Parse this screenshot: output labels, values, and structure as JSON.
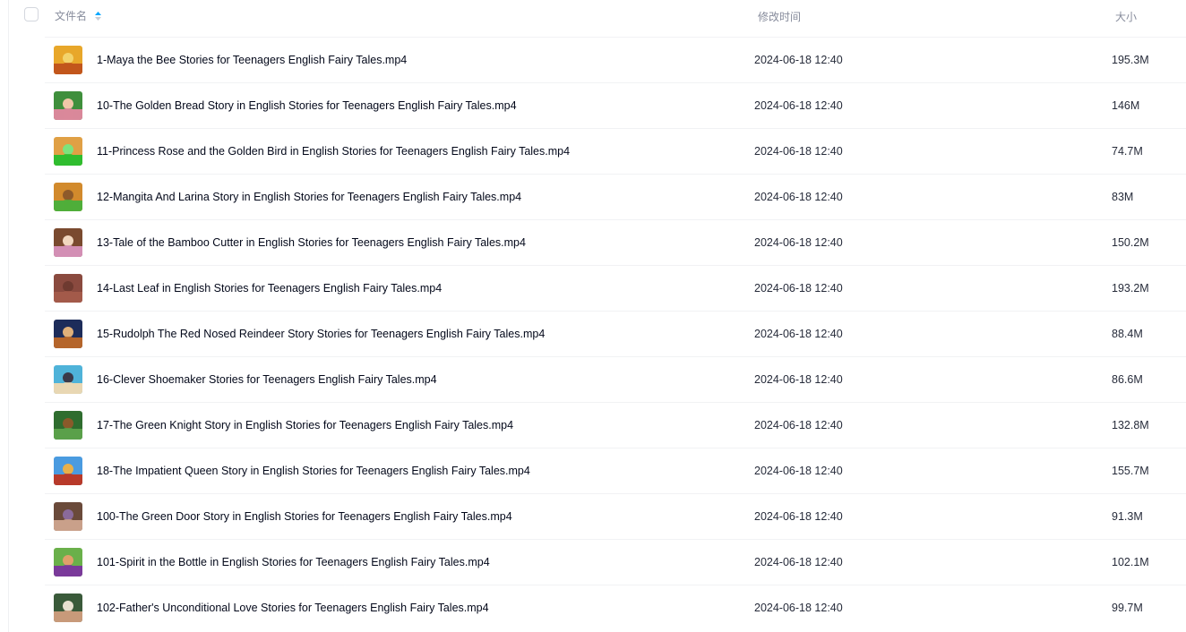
{
  "header": {
    "name_label": "文件名",
    "time_label": "修改时间",
    "size_label": "大小",
    "sort_icon": "sort-ascending-icon",
    "accent": "#06a7ff"
  },
  "files": [
    {
      "name": "1-Maya the Bee Stories for Teenagers English Fairy Tales.mp4",
      "time": "2024-06-18 12:40",
      "size": "195.3M"
    },
    {
      "name": "10-The Golden Bread Story in English Stories for Teenagers English Fairy Tales.mp4",
      "time": "2024-06-18 12:40",
      "size": "146M"
    },
    {
      "name": "11-Princess Rose and the Golden Bird in English Stories for Teenagers English Fairy Tales.mp4",
      "time": "2024-06-18 12:40",
      "size": "74.7M"
    },
    {
      "name": "12-Mangita And Larina Story in English Stories for Teenagers English Fairy Tales.mp4",
      "time": "2024-06-18 12:40",
      "size": "83M"
    },
    {
      "name": "13-Tale of the Bamboo Cutter in English Stories for Teenagers English Fairy Tales.mp4",
      "time": "2024-06-18 12:40",
      "size": "150.2M"
    },
    {
      "name": "14-Last Leaf in English Stories for Teenagers English Fairy Tales.mp4",
      "time": "2024-06-18 12:40",
      "size": "193.2M"
    },
    {
      "name": "15-Rudolph The Red Nosed Reindeer Story Stories for Teenagers English Fairy Tales.mp4",
      "time": "2024-06-18 12:40",
      "size": "88.4M"
    },
    {
      "name": "16-Clever Shoemaker Stories for Teenagers English Fairy Tales.mp4",
      "time": "2024-06-18 12:40",
      "size": "86.6M"
    },
    {
      "name": "17-The Green Knight Story in English Stories for Teenagers English Fairy Tales.mp4",
      "time": "2024-06-18 12:40",
      "size": "132.8M"
    },
    {
      "name": "18-The Impatient Queen Story in English Stories for Teenagers English Fairy Tales.mp4",
      "time": "2024-06-18 12:40",
      "size": "155.7M"
    },
    {
      "name": "100-The Green Door Story in English Stories for Teenagers English Fairy Tales.mp4",
      "time": "2024-06-18 12:40",
      "size": "91.3M"
    },
    {
      "name": "101-Spirit in the Bottle in English Stories for Teenagers English Fairy Tales.mp4",
      "time": "2024-06-18 12:40",
      "size": "102.1M"
    },
    {
      "name": "102-Father's Unconditional Love Stories for Teenagers English Fairy Tales.mp4",
      "time": "2024-06-18 12:40",
      "size": "99.7M"
    }
  ],
  "thumb_colors": [
    [
      "#e8a72a",
      "#c2561c",
      "#f3d36b"
    ],
    [
      "#3f8f3c",
      "#d9889a",
      "#f0c7a8"
    ],
    [
      "#e0a045",
      "#2fbd2f",
      "#7de37d"
    ],
    [
      "#d28a2c",
      "#4fae3a",
      "#8e5a2a"
    ],
    [
      "#7a4a2f",
      "#d38fb5",
      "#f1d7bf"
    ],
    [
      "#8a4a3f",
      "#a35a4a",
      "#6e3a30"
    ],
    [
      "#1d2c5a",
      "#b5652b",
      "#e0b07a"
    ],
    [
      "#4fb3d9",
      "#e8d7b3",
      "#3a3a4a"
    ],
    [
      "#2f6d2f",
      "#5aa04a",
      "#8a5a2a"
    ],
    [
      "#4a9be0",
      "#b83a2a",
      "#e8b04a"
    ],
    [
      "#6a4a3a",
      "#c9a08a",
      "#8a6a9a"
    ],
    [
      "#6ab04a",
      "#7a3a9a",
      "#e0a06a"
    ],
    [
      "#3a5a3a",
      "#c89a7a",
      "#e8e0d0"
    ]
  ]
}
